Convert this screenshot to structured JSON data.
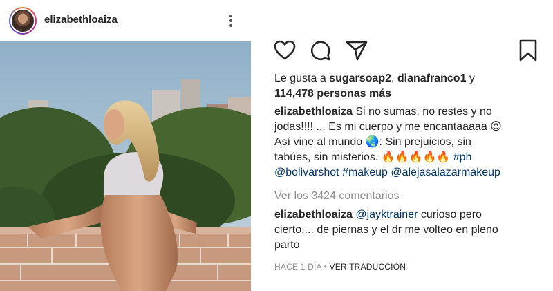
{
  "post": {
    "username": "elizabethloaiza"
  },
  "actions": {
    "like_icon": "heart-icon",
    "comment_icon": "comment-icon",
    "share_icon": "send-icon",
    "save_icon": "bookmark-icon"
  },
  "likes": {
    "prefix": "Le gusta a ",
    "user1": "sugarsoap2",
    "sep": ", ",
    "user2": "dianafranco1",
    "and": " y",
    "count": "114,478 personas más"
  },
  "caption": {
    "author": "elizabethloaiza",
    "line1": " Si no sumas, no restes y no",
    "line2": "jodas!!!! ... Es mi cuerpo y me encantaaaaa 😍",
    "line3": "Así vine al mundo 🌏: Sin prejuicios, sin",
    "line4": "tabúes, sin misterios. 🔥🔥🔥🔥🔥 ",
    "tag_ph": "#ph",
    "tag_bolivar": "@bolivarshot",
    "tag_makeup": "#makeup",
    "tag_aleja": "@alejasalazarmakeup"
  },
  "comments_link": "Ver los 3424 comentarios",
  "comment": {
    "author": "elizabethloaiza",
    "mention": "@jayktrainer",
    "text1": " curioso pero",
    "text2": "cierto.... de piernas y el dr me volteo en pleno",
    "text3": "parto"
  },
  "footer": {
    "time": "HACE 1 DÍA",
    "dot": " • ",
    "translate": "VER TRADUCCIÓN"
  },
  "colors": {
    "text": "#262626",
    "link": "#003569",
    "muted": "#8e8e8e"
  }
}
